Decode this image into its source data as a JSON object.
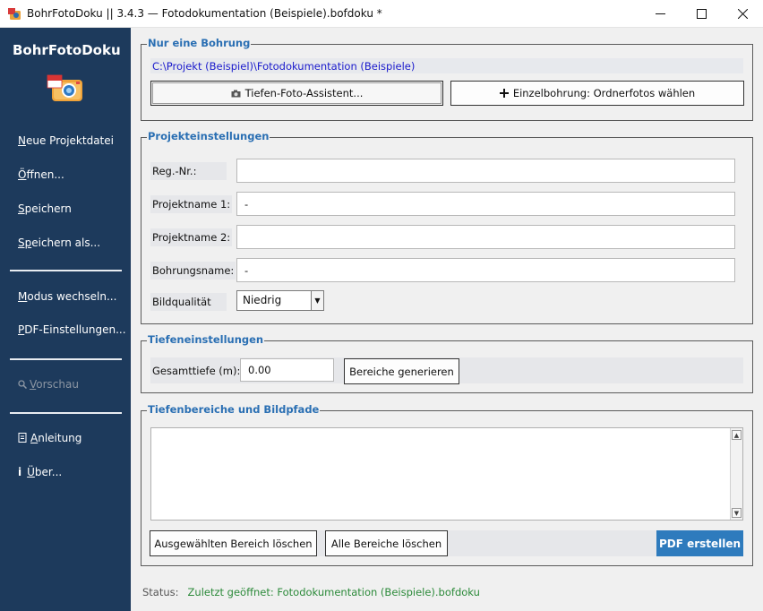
{
  "window": {
    "title": "BohrFotoDoku || 3.4.3 — Fotodokumentation (Beispiele).bofdoku *"
  },
  "sidebar": {
    "brand": "BohrFotoDoku",
    "items": [
      {
        "underline": "N",
        "rest": "eue Projektdatei"
      },
      {
        "underline": "Ö",
        "rest": "ffnen..."
      },
      {
        "underline": "S",
        "rest": "peichern"
      },
      {
        "underline": "Sp",
        "rest": "eichern als..."
      },
      {
        "underline": "M",
        "rest": "odus wechseln..."
      },
      {
        "underline": "P",
        "rest": "DF-Einstellungen..."
      },
      {
        "underline": "V",
        "rest": "orschau"
      },
      {
        "underline": "A",
        "rest": "nleitung"
      },
      {
        "underline": "Ü",
        "rest": "ber..."
      }
    ],
    "info_prefix": "i"
  },
  "single_bore": {
    "title": "Nur eine Bohrung",
    "path": "C:\\Projekt (Beispiel)\\Fotodokumentation (Beispiele)",
    "wizard_button": "Tiefen-Foto-Assistent...",
    "folder_button": "Einzelbohrung: Ordnerfotos wählen"
  },
  "project_settings": {
    "title": "Projekteinstellungen",
    "fields": [
      {
        "label": "Reg.-Nr.:",
        "value": ""
      },
      {
        "label": "Projektname 1:",
        "value": "-"
      },
      {
        "label": "Projektname 2:",
        "value": ""
      },
      {
        "label": "Bohrungsname:",
        "value": "-"
      }
    ],
    "quality_label": "Bildqualität",
    "quality_value": "Niedrig"
  },
  "depth_settings": {
    "title": "Tiefeneinstellungen",
    "total_label": "Gesamttiefe (m):",
    "total_value": "0.00",
    "generate_button": "Bereiche generieren"
  },
  "ranges": {
    "title": "Tiefenbereiche und Bildpfade",
    "delete_selected_button": "Ausgewählten Bereich löschen",
    "delete_all_button": "Alle Bereiche löschen",
    "create_pdf_button": "PDF erstellen"
  },
  "status": {
    "label": "Status:",
    "text": "Zuletzt geöffnet: Fotodokumentation (Beispiele).bofdoku"
  }
}
